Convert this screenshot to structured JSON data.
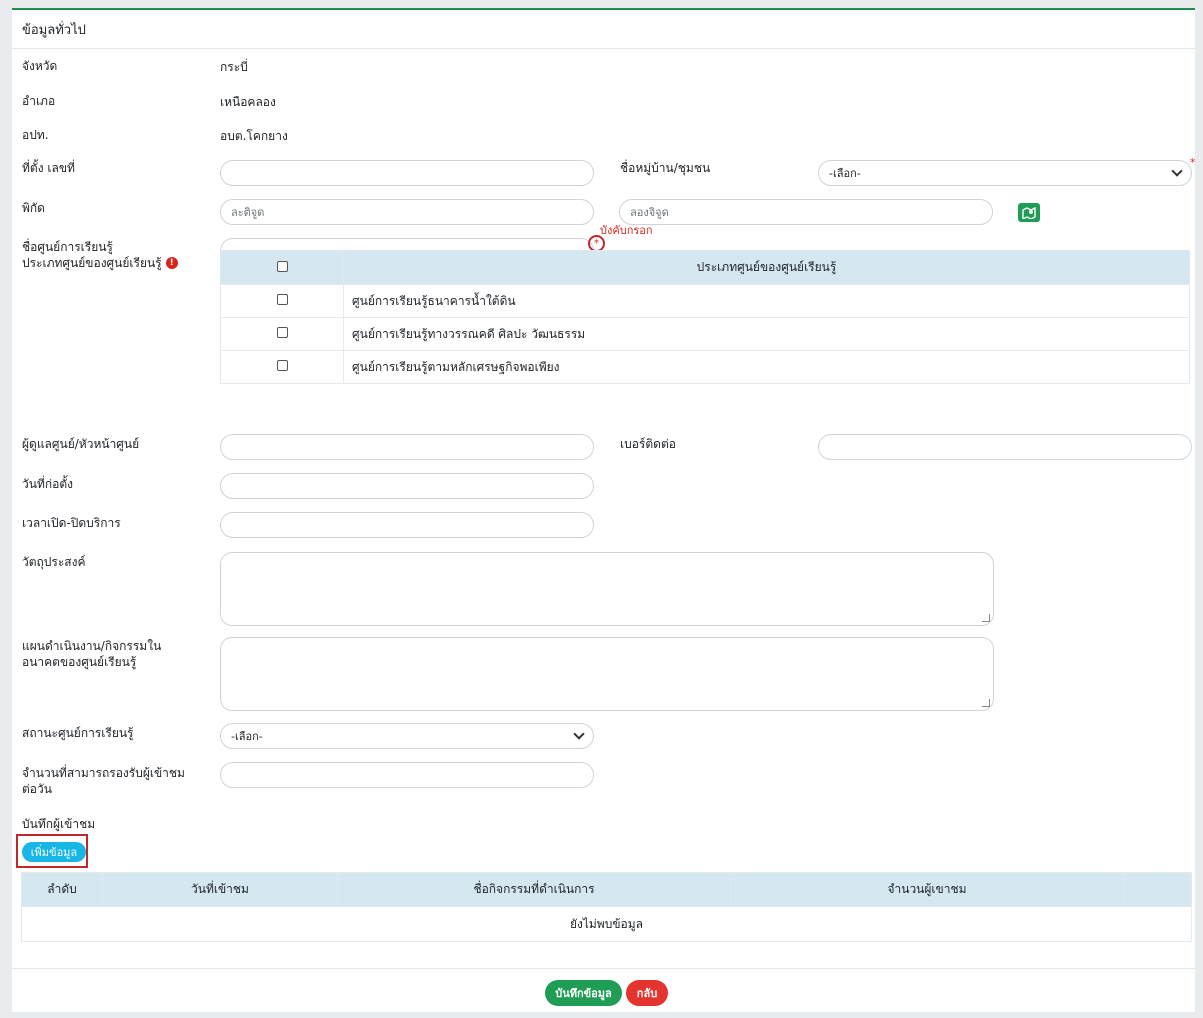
{
  "section_title": "ข้อมูลทั่วไป",
  "province": {
    "label": "จังหวัด",
    "value": "กระบี่"
  },
  "district": {
    "label": "อำเภอ",
    "value": "เหนือคลอง"
  },
  "lao": {
    "label": "อปท.",
    "value": "อบต.โคกยาง"
  },
  "address": {
    "label": "ที่ตั้ง เลขที่",
    "value": ""
  },
  "village": {
    "label": "ชื่อหมู่บ้าน/ชุมชน",
    "selected": "-เลือก-",
    "required_mark": "*"
  },
  "coords": {
    "label": "พิกัด",
    "lat_placeholder": "ละติจูด",
    "lng_placeholder": "ลองจิจูด",
    "map_icon": "map-icon"
  },
  "center_name": {
    "label": "ชื่อศูนย์การเรียนรู้",
    "value": "",
    "required_mark": "*",
    "required_note": "บังคับกรอก"
  },
  "center_type": {
    "label": "ประเภทศูนย์ของศูนย์เรียนรู้",
    "info_icon": "exclamation-circle-icon",
    "header": "ประเภทศูนย์ของศูนย์เรียนรู้",
    "options": [
      "ศูนย์การเรียนรู้ธนาคารน้ำใต้ดิน",
      "ศูนย์การเรียนรู้ทางวรรณคดี ศิลปะ วัฒนธรรม",
      "ศูนย์การเรียนรู้ตามหลักเศรษฐกิจพอเพียง"
    ]
  },
  "manager": {
    "label": "ผู้ดูแลศูนย์/หัวหน้าศูนย์",
    "value": ""
  },
  "phone": {
    "label": "เบอร์ติดต่อ",
    "value": ""
  },
  "founded": {
    "label": "วันที่ก่อตั้ง",
    "value": ""
  },
  "hours": {
    "label": "เวลาเปิด-ปิดบริการ",
    "value": ""
  },
  "objective": {
    "label": "วัตถุประสงค์",
    "value": ""
  },
  "plan": {
    "label_line1": "แผนดำเนินงาน/กิจกรรมใน",
    "label_line2": "อนาคตของศูนย์เรียนรู้",
    "value": ""
  },
  "status": {
    "label": "สถานะศูนย์การเรียนรู้",
    "selected": "-เลือก-"
  },
  "capacity": {
    "label_line1": "จำนวนที่สามารถรองรับผู้เข้าชม",
    "label_line2": "ต่อวัน",
    "value": ""
  },
  "visitors": {
    "label": "บันทึกผู้เข้าชม",
    "add_button": "เพิ่มข้อมูล",
    "columns": [
      "ลำดับ",
      "วันที่เข้าชม",
      "ชื่อกิจกรรมที่ดำเนินการ",
      "จำนวนผู้เขาชม",
      ""
    ],
    "empty_text": "ยังไม่พบข้อมูล"
  },
  "footer": {
    "save_button": "บันทึกข้อมูล",
    "back_button": "กลับ"
  },
  "colors": {
    "primary_green": "#1f9d55",
    "danger": "#e3342f",
    "info": "#17b6e6",
    "table_header": "#d5e8f2",
    "header_border": "#1f8f4f"
  }
}
